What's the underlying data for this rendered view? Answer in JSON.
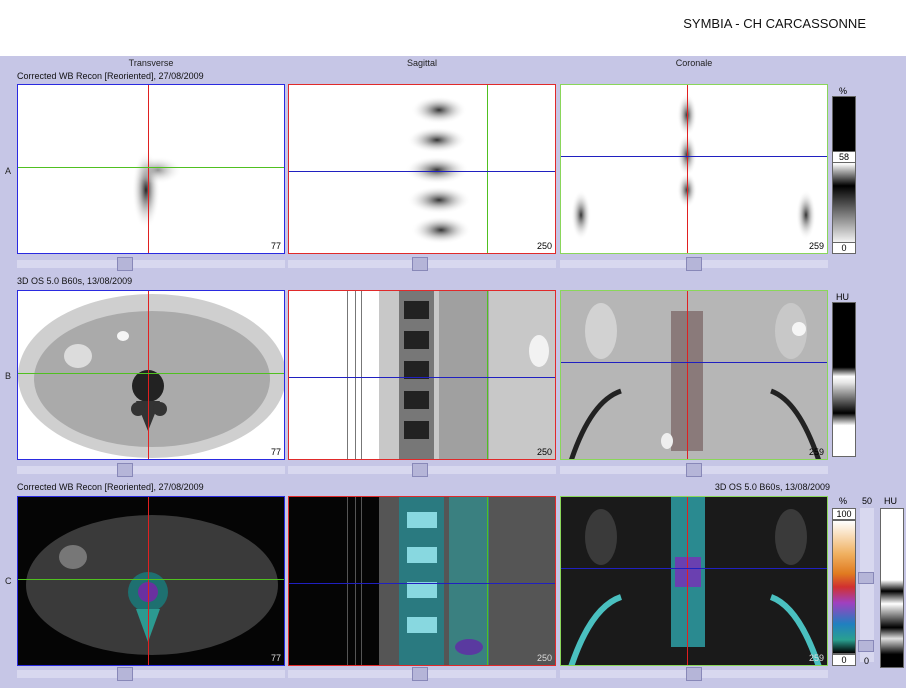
{
  "header": {
    "site": "SYMBIA - CH CARCASSONNE"
  },
  "columns": [
    "Transverse",
    "Sagittal",
    "Coronale"
  ],
  "rows": [
    {
      "letter": "A",
      "caption_left": "Corrected WB Recon [Reoriented], 27/08/2009",
      "caption_right": ""
    },
    {
      "letter": "B",
      "caption_left": "3D  OS  5.0  B60s, 13/08/2009",
      "caption_right": ""
    },
    {
      "letter": "C",
      "caption_left": "Corrected WB Recon [Reoriented], 27/08/2009",
      "caption_right": "3D  OS  5.0  B60s, 13/08/2009"
    }
  ],
  "slices": {
    "A": [
      "77",
      "250",
      "259"
    ],
    "B": [
      "77",
      "250",
      "259"
    ],
    "C": [
      "77",
      "250",
      "259"
    ]
  },
  "colorbars": {
    "A": {
      "unit": "%",
      "mid": "58",
      "bottom": "0"
    },
    "B": {
      "unit": "HU"
    },
    "C": {
      "unit": "%",
      "top": "100",
      "bottom": "0",
      "second_top": "50",
      "second_bottom": "0",
      "second_unit": "HU"
    }
  }
}
